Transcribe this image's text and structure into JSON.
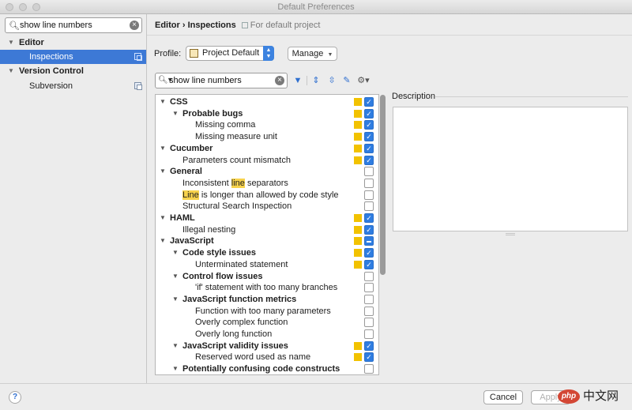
{
  "window": {
    "title": "Default Preferences"
  },
  "sidebar": {
    "search_value": "show line numbers",
    "items": [
      {
        "label": "Editor",
        "level": 0,
        "expanded": true,
        "selected": false
      },
      {
        "label": "Inspections",
        "level": 1,
        "selected": true
      },
      {
        "label": "Version Control",
        "level": 0,
        "expanded": true,
        "selected": false
      },
      {
        "label": "Subversion",
        "level": 1,
        "selected": false
      }
    ]
  },
  "header": {
    "breadcrumb_section": "Editor",
    "breadcrumb_sep": "›",
    "breadcrumb_page": "Inspections",
    "scope_label": "For default project"
  },
  "profile": {
    "label": "Profile:",
    "selected": "Project Default",
    "manage_label": "Manage"
  },
  "filter": {
    "value": "show line numbers"
  },
  "inspections": [
    {
      "parts": [
        {
          "t": "CSS"
        }
      ],
      "level": 0,
      "bold": true,
      "expander": true,
      "severity": true,
      "state": "checked"
    },
    {
      "parts": [
        {
          "t": "Probable bugs"
        }
      ],
      "level": 1,
      "bold": true,
      "expander": true,
      "severity": true,
      "state": "checked"
    },
    {
      "parts": [
        {
          "t": "Missing comma"
        }
      ],
      "level": 2,
      "bold": false,
      "expander": false,
      "severity": true,
      "state": "checked"
    },
    {
      "parts": [
        {
          "t": "Missing measure unit"
        }
      ],
      "level": 2,
      "bold": false,
      "expander": false,
      "severity": true,
      "state": "checked"
    },
    {
      "parts": [
        {
          "t": "Cucumber"
        }
      ],
      "level": 0,
      "bold": true,
      "expander": true,
      "severity": true,
      "state": "checked"
    },
    {
      "parts": [
        {
          "t": "Parameters count mismatch"
        }
      ],
      "level": 1,
      "bold": false,
      "expander": false,
      "severity": true,
      "state": "checked"
    },
    {
      "parts": [
        {
          "t": "General"
        }
      ],
      "level": 0,
      "bold": true,
      "expander": true,
      "severity": false,
      "state": "unchecked"
    },
    {
      "parts": [
        {
          "t": "Inconsistent "
        },
        {
          "t": "line",
          "hl": true
        },
        {
          "t": " separators"
        }
      ],
      "level": 1,
      "bold": false,
      "expander": false,
      "severity": false,
      "state": "unchecked"
    },
    {
      "parts": [
        {
          "t": "Line",
          "hl": true
        },
        {
          "t": " is longer than allowed by code style"
        }
      ],
      "level": 1,
      "bold": false,
      "expander": false,
      "severity": false,
      "state": "unchecked"
    },
    {
      "parts": [
        {
          "t": "Structural Search Inspection"
        }
      ],
      "level": 1,
      "bold": false,
      "expander": false,
      "severity": false,
      "state": "unchecked"
    },
    {
      "parts": [
        {
          "t": "HAML"
        }
      ],
      "level": 0,
      "bold": true,
      "expander": true,
      "severity": true,
      "state": "checked"
    },
    {
      "parts": [
        {
          "t": "Illegal nesting"
        }
      ],
      "level": 1,
      "bold": false,
      "expander": false,
      "severity": true,
      "state": "checked"
    },
    {
      "parts": [
        {
          "t": "JavaScript"
        }
      ],
      "level": 0,
      "bold": true,
      "expander": true,
      "severity": true,
      "state": "mixed"
    },
    {
      "parts": [
        {
          "t": "Code style issues"
        }
      ],
      "level": 1,
      "bold": true,
      "expander": true,
      "severity": true,
      "state": "checked"
    },
    {
      "parts": [
        {
          "t": "Unterminated statement"
        }
      ],
      "level": 2,
      "bold": false,
      "expander": false,
      "severity": true,
      "state": "checked"
    },
    {
      "parts": [
        {
          "t": "Control flow issues"
        }
      ],
      "level": 1,
      "bold": true,
      "expander": true,
      "severity": false,
      "state": "unchecked"
    },
    {
      "parts": [
        {
          "t": "'if' statement with too many branches"
        }
      ],
      "level": 2,
      "bold": false,
      "expander": false,
      "severity": false,
      "state": "unchecked"
    },
    {
      "parts": [
        {
          "t": "JavaScript function metrics"
        }
      ],
      "level": 1,
      "bold": true,
      "expander": true,
      "severity": false,
      "state": "unchecked"
    },
    {
      "parts": [
        {
          "t": "Function with too many parameters"
        }
      ],
      "level": 2,
      "bold": false,
      "expander": false,
      "severity": false,
      "state": "unchecked"
    },
    {
      "parts": [
        {
          "t": "Overly complex function"
        }
      ],
      "level": 2,
      "bold": false,
      "expander": false,
      "severity": false,
      "state": "unchecked"
    },
    {
      "parts": [
        {
          "t": "Overly long function"
        }
      ],
      "level": 2,
      "bold": false,
      "expander": false,
      "severity": false,
      "state": "unchecked"
    },
    {
      "parts": [
        {
          "t": "JavaScript validity issues"
        }
      ],
      "level": 1,
      "bold": true,
      "expander": true,
      "severity": true,
      "state": "checked"
    },
    {
      "parts": [
        {
          "t": "Reserved word used as name"
        }
      ],
      "level": 2,
      "bold": false,
      "expander": false,
      "severity": true,
      "state": "checked"
    },
    {
      "parts": [
        {
          "t": "Potentially confusing code constructs"
        }
      ],
      "level": 1,
      "bold": true,
      "expander": true,
      "severity": false,
      "state": "unchecked"
    }
  ],
  "description": {
    "label": "Description"
  },
  "footer": {
    "help_label": "?",
    "cancel_label": "Cancel",
    "apply_label": "Apply",
    "watermark_badge": "php",
    "watermark_text": "中文网"
  },
  "colors": {
    "selection": "#3d79d6",
    "severity_warning": "#f2c200",
    "checkbox_checked": "#2f7de1",
    "highlight": "#f7d24b"
  }
}
